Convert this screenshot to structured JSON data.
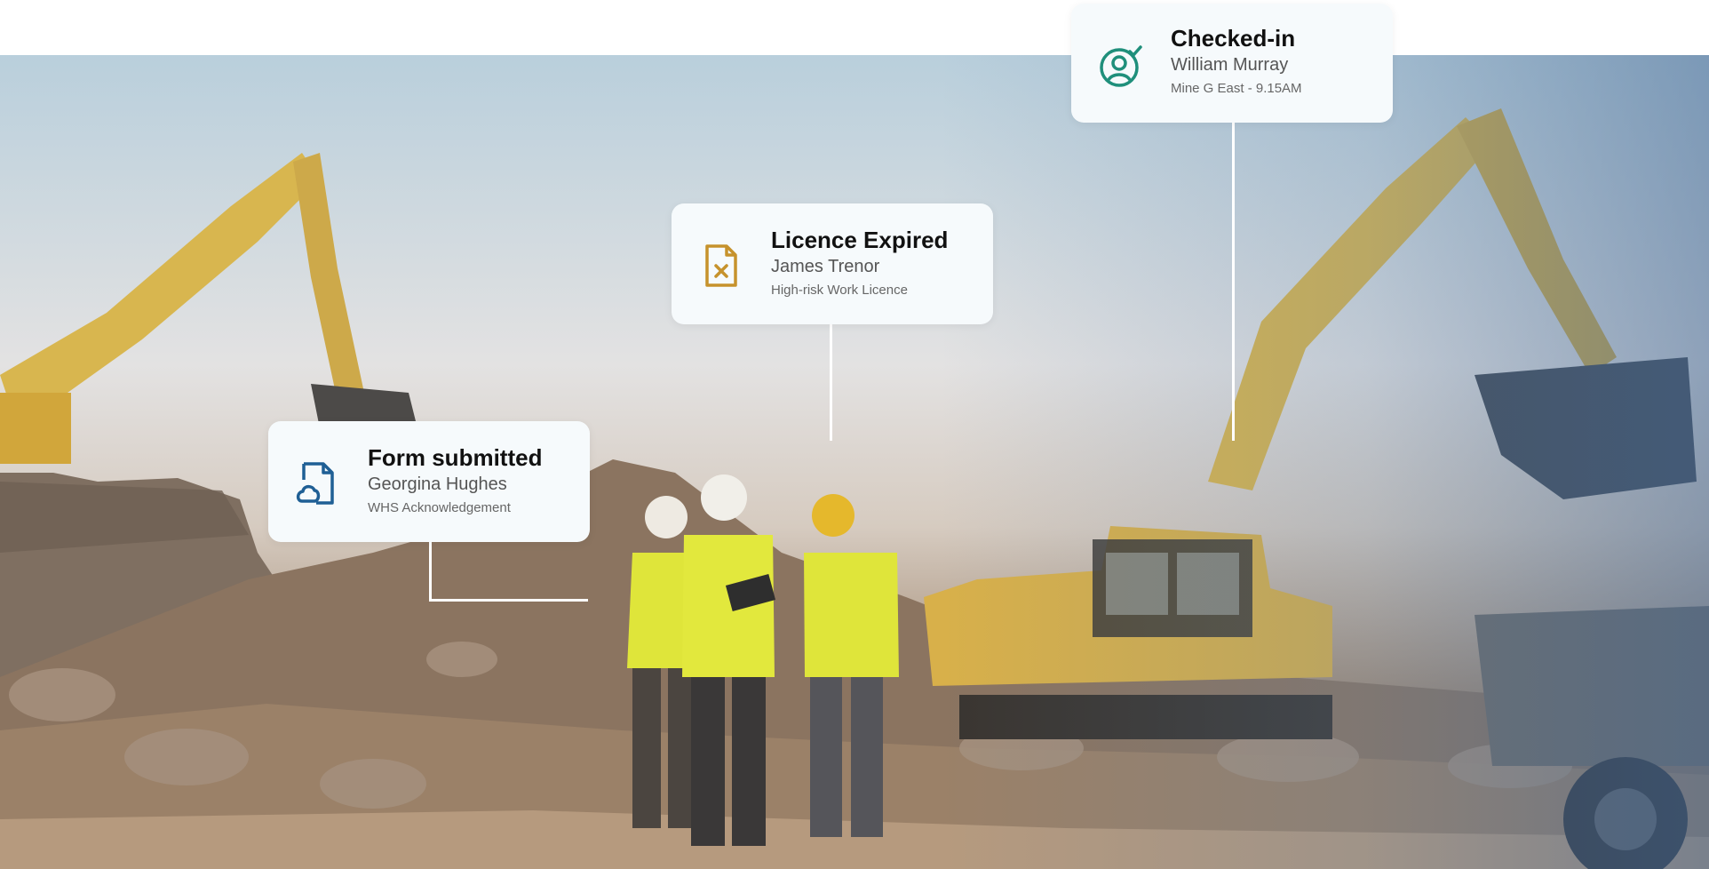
{
  "scene": {
    "image_description_icon": "construction-site-photo"
  },
  "cards": {
    "checked_in": {
      "title": "Checked-in",
      "name": "William Murray",
      "detail": "Mine G East - 9.15AM",
      "icon": "user-check-icon",
      "icon_color": "#1f8f7b"
    },
    "licence_expired": {
      "title": "Licence Expired",
      "name": "James Trenor",
      "detail": "High-risk Work Licence",
      "icon": "document-x-icon",
      "icon_color": "#c6922c"
    },
    "form_submitted": {
      "title": "Form submitted",
      "name": "Georgina Hughes",
      "detail": "WHS Acknowledgement",
      "icon": "document-cloud-icon",
      "icon_color": "#1f5f95"
    }
  }
}
